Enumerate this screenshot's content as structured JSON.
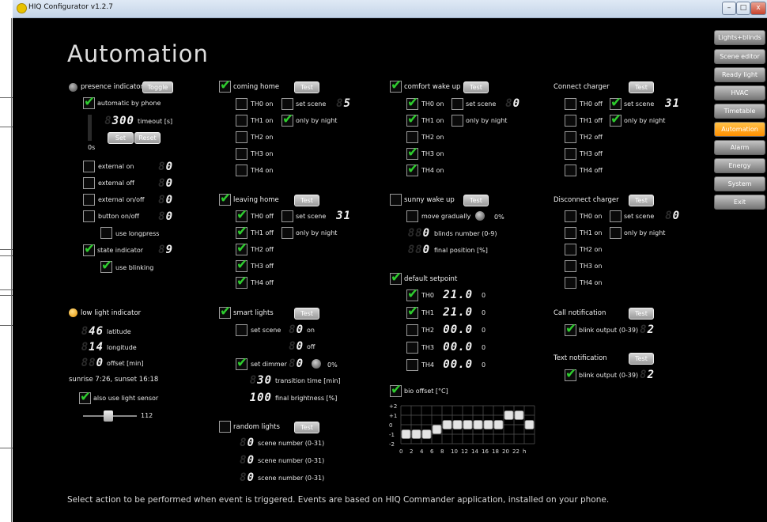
{
  "window": {
    "title": "HIQ Configurator v1.2.7",
    "min": "–",
    "max": "□",
    "close": "x"
  },
  "page_title": "Automation",
  "footer": "Select action to be performed when event is triggered. Events are based on HIQ Commander application, installed on your phone.",
  "nav": [
    "Lights+blinds",
    "Scene editor",
    "Ready light",
    "HVAC",
    "Timetable",
    "Automation",
    "Alarm",
    "Energy",
    "System",
    "Exit"
  ],
  "presence": {
    "label": "presence indicator",
    "toggle": "Toggle",
    "auto": "automatic by phone",
    "timeout_value": "300",
    "timeout_label": "timeout [s]",
    "zero": "0s",
    "set": "Set",
    "reset": "Reset",
    "rows": [
      {
        "label": "external on",
        "value": "0"
      },
      {
        "label": "external off",
        "value": "0"
      },
      {
        "label": "external on/off",
        "value": "0"
      },
      {
        "label": "button on/off",
        "value": "0"
      }
    ],
    "longpress": "use longpress",
    "state": "state indicator",
    "state_value": "9",
    "blinking": "use blinking"
  },
  "lowlight": {
    "label": "low light indicator",
    "lat_value": "46",
    "lat": "latitude",
    "lon_value": "14",
    "lon": "longitude",
    "off_value": "0",
    "off": "offset [min]",
    "sun": "sunrise 7:26, sunset 16:18",
    "sensor": "also use light sensor",
    "slider_value": "112"
  },
  "coming": {
    "label": "coming home",
    "test": "Test",
    "th": [
      "TH0 on",
      "TH1 on",
      "TH2 on",
      "TH3 on",
      "TH4 on"
    ],
    "scene": "set scene",
    "scene_value": "5",
    "night": "only by night"
  },
  "leaving": {
    "label": "leaving home",
    "test": "Test",
    "th": [
      "TH0 off",
      "TH1 off",
      "TH2 off",
      "TH3 off",
      "TH4 off"
    ],
    "scene": "set scene",
    "scene_value": "31",
    "night": "only by night"
  },
  "smart": {
    "label": "smart lights",
    "test": "Test",
    "scene": "set scene",
    "on_value": "0",
    "on": "on",
    "off_value": "0",
    "off": "off",
    "dimmer": "set dimmer",
    "dim_value": "0",
    "dim_pct": "0%",
    "trans_value": "30",
    "trans": "transition time [min]",
    "bright_value": "100",
    "bright": "final brightness [%]"
  },
  "random": {
    "label": "random lights",
    "test": "Test",
    "rows": [
      {
        "value": "0",
        "label": "scene number (0-31)"
      },
      {
        "value": "0",
        "label": "scene number (0-31)"
      },
      {
        "value": "0",
        "label": "scene number (0-31)"
      }
    ]
  },
  "comfort": {
    "label": "comfort wake up",
    "test": "Test",
    "th": [
      "TH0 on",
      "TH1 on",
      "TH2 on",
      "TH3 on",
      "TH4 on"
    ],
    "scene": "set scene",
    "scene_value": "0",
    "night": "only by night"
  },
  "sunny": {
    "label": "sunny wake up",
    "test": "Test",
    "move": "move gradually",
    "move_pct": "0%",
    "blinds_value": "0",
    "blinds": "blinds number (0-9)",
    "final_value": "0",
    "final": "final position [%]"
  },
  "setpoint": {
    "label": "default setpoint",
    "rows": [
      {
        "th": "TH0",
        "value": "21.0",
        "n": "0"
      },
      {
        "th": "TH1",
        "value": "21.0",
        "n": "0"
      },
      {
        "th": "TH2",
        "value": "00.0",
        "n": "0"
      },
      {
        "th": "TH3",
        "value": "00.0",
        "n": "0"
      },
      {
        "th": "TH4",
        "value": "00.0",
        "n": "0"
      }
    ]
  },
  "bio": {
    "label": "bio offset [°C]",
    "yticks": [
      "+2",
      "+1",
      "0",
      "-1",
      "-2"
    ],
    "xticks": [
      "0",
      "2",
      "4",
      "6",
      "8",
      "10",
      "12",
      "14",
      "16",
      "18",
      "20",
      "22",
      "h"
    ],
    "offsets": [
      -1,
      -1,
      -1,
      -0.5,
      0,
      0,
      0,
      0,
      0,
      0,
      1,
      1,
      0
    ]
  },
  "connect": {
    "label": "Connect charger",
    "test": "Test",
    "th": [
      "TH0 off",
      "TH1 off",
      "TH2 off",
      "TH3 off",
      "TH4 off"
    ],
    "scene": "set scene",
    "scene_value": "31",
    "night": "only by night"
  },
  "disconnect": {
    "label": "Disconnect charger",
    "test": "Test",
    "th": [
      "TH0 on",
      "TH1 on",
      "TH2 on",
      "TH3 on",
      "TH4 on"
    ],
    "scene": "set scene",
    "scene_value": "0",
    "night": "only by night"
  },
  "call": {
    "label": "Call notification",
    "test": "Test",
    "blink": "blink output (0-39)",
    "value": "2"
  },
  "text": {
    "label": "Text notification",
    "test": "Test",
    "blink": "blink output (0-39)",
    "value": "2"
  }
}
